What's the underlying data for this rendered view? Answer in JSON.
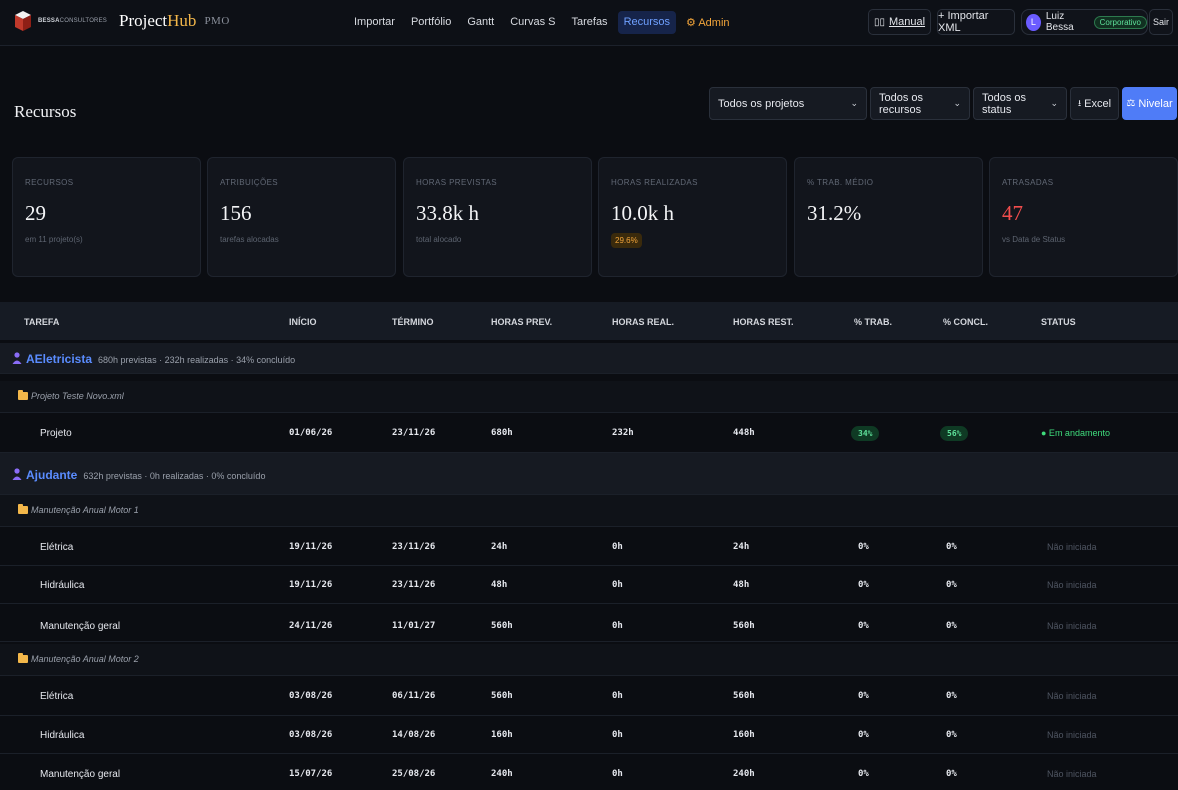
{
  "brand": {
    "company_bold": "BESSA",
    "company_light": "CONSULTORES",
    "name_main": "Project",
    "name_hub": "Hub",
    "suffix": "PMO"
  },
  "nav": {
    "items": [
      "Importar",
      "Portfólio",
      "Gantt",
      "Curvas S",
      "Tarefas",
      "Recursos",
      "⚙ Admin"
    ],
    "active": "Recursos"
  },
  "topbar": {
    "manual": "Manual",
    "import_xml": "+ Importar XML",
    "user_initial": "L",
    "user_name": "Luiz Bessa",
    "plan_badge": "Corporativo",
    "logout": "Sair"
  },
  "page": {
    "title": "Recursos"
  },
  "filters": {
    "projects": "Todos os projetos",
    "resources": "Todos os recursos",
    "status": "Todos os status",
    "excel": "Excel",
    "level": "Nivelar"
  },
  "stats": [
    {
      "label": "RECURSOS",
      "value": "29",
      "sub": "em 11 projeto(s)"
    },
    {
      "label": "ATRIBUIÇÕES",
      "value": "156",
      "sub": "tarefas alocadas"
    },
    {
      "label": "HORAS PREVISTAS",
      "value": "33.8k h",
      "sub": "total alocado"
    },
    {
      "label": "HORAS REALIZADAS",
      "value": "10.0k h",
      "badge": "29.6%"
    },
    {
      "label": "% TRAB. MÉDIO",
      "value": "31.2%"
    },
    {
      "label": "ATRASADAS",
      "value": "47",
      "sub": "vs Data de Status"
    }
  ],
  "table": {
    "headers": [
      "TAREFA",
      "INÍCIO",
      "TÉRMINO",
      "HORAS PREV.",
      "HORAS REAL.",
      "HORAS REST.",
      "% TRAB.",
      "% CONCL.",
      "STATUS"
    ],
    "resources": [
      {
        "name": "AEletricista",
        "meta": "680h previstas · 232h realizadas · 34% concluído"
      },
      {
        "name": "Ajudante",
        "meta": "632h previstas · 0h realizadas · 0% concluído"
      }
    ],
    "projects": [
      "Projeto Teste Novo.xml",
      "Manutenção Anual Motor 1",
      "Manutenção Anual Motor 2"
    ],
    "rows": [
      {
        "task": "Projeto",
        "start": "01/06/26",
        "end": "23/11/26",
        "prev": "680h",
        "real": "232h",
        "rest": "448h",
        "trab": "34%",
        "concl": "56%",
        "status": "● Em andamento"
      },
      {
        "task": "Elétrica",
        "start": "19/11/26",
        "end": "23/11/26",
        "prev": "24h",
        "real": "0h",
        "rest": "24h",
        "trab": "0%",
        "concl": "0%",
        "status": "Não iniciada"
      },
      {
        "task": "Hidráulica",
        "start": "19/11/26",
        "end": "23/11/26",
        "prev": "48h",
        "real": "0h",
        "rest": "48h",
        "trab": "0%",
        "concl": "0%",
        "status": "Não iniciada"
      },
      {
        "task": "Manutenção geral",
        "start": "24/11/26",
        "end": "11/01/27",
        "prev": "560h",
        "real": "0h",
        "rest": "560h",
        "trab": "0%",
        "concl": "0%",
        "status": "Não iniciada"
      },
      {
        "task": "Elétrica",
        "start": "03/08/26",
        "end": "06/11/26",
        "prev": "560h",
        "real": "0h",
        "rest": "560h",
        "trab": "0%",
        "concl": "0%",
        "status": "Não iniciada"
      },
      {
        "task": "Hidráulica",
        "start": "03/08/26",
        "end": "14/08/26",
        "prev": "160h",
        "real": "0h",
        "rest": "160h",
        "trab": "0%",
        "concl": "0%",
        "status": "Não iniciada"
      },
      {
        "task": "Manutenção geral",
        "start": "15/07/26",
        "end": "25/08/26",
        "prev": "240h",
        "real": "0h",
        "rest": "240h",
        "trab": "0%",
        "concl": "0%",
        "status": "Não iniciada"
      }
    ]
  },
  "colors": {
    "accent": "#4f7cf7",
    "brand_gold": "#f3b74a",
    "danger": "#f24d4d",
    "success": "#3fdc7c",
    "background": "#0b0d12"
  }
}
